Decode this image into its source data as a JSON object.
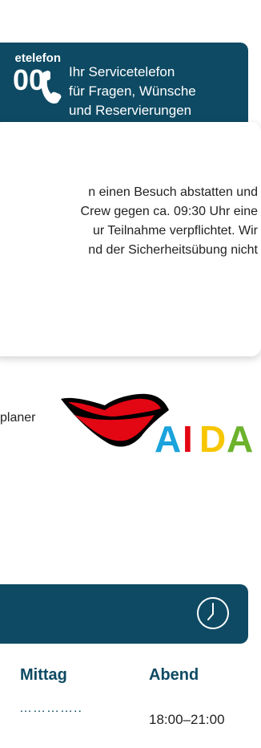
{
  "service": {
    "small_label": "etelefon",
    "number_fragment": "00",
    "text_line1": "Ihr Servicetelefon",
    "text_line2": "für Fragen, Wünsche",
    "text_line3": "und Reservierungen"
  },
  "info": {
    "line1": "n einen Besuch abstatten und",
    "line2": "Crew gegen ca. 09:30 Uhr eine",
    "line3": "ur Teilnahme verpflichtet. Wir",
    "line4": "nd der Sicherheitsübung nicht"
  },
  "planer_label": "planer",
  "logo": {
    "text": "AIDA",
    "colors": [
      "#1aa3dc",
      "#e30613",
      "#f7c600",
      "#6cb22c"
    ]
  },
  "times": {
    "col_mittag": "Mittag",
    "col_abend": "Abend",
    "mittag_value": "…………..",
    "abend_value": "18:00–21:00"
  },
  "colors": {
    "brand_dark": "#0e4a63"
  }
}
